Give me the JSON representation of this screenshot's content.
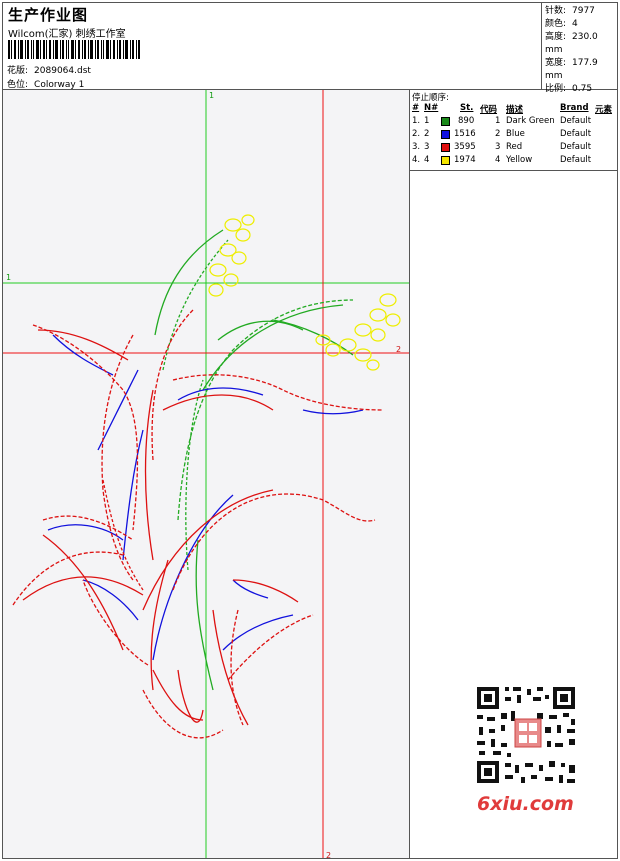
{
  "header": {
    "title": "生产作业图",
    "subtitle": "Wilcom(汇家) 刺绣工作室",
    "design_label": "花版:",
    "design_file": "2089064.dst",
    "color_label": "色位:",
    "colorway": "Colorway 1"
  },
  "stats": [
    {
      "key": "针数:",
      "value": "7977"
    },
    {
      "key": "颜色:",
      "value": "4"
    },
    {
      "key": "高度:",
      "value": "230.0 mm"
    },
    {
      "key": "宽度:",
      "value": "177.9 mm"
    },
    {
      "key": "比例:",
      "value": "0.75"
    }
  ],
  "stop_table": {
    "title": "停止顺序:",
    "headers": [
      "#",
      "N#",
      "St.",
      "代码",
      "描述",
      "Brand",
      "元素"
    ],
    "rows": [
      {
        "idx": "1.",
        "n": "1",
        "color": "#1a8a1a",
        "st": "890",
        "code": "1",
        "desc": "Dark Green",
        "brand": "Default"
      },
      {
        "idx": "2.",
        "n": "2",
        "color": "#1010e0",
        "st": "1516",
        "code": "2",
        "desc": "Blue",
        "brand": "Default"
      },
      {
        "idx": "3.",
        "n": "3",
        "color": "#e01010",
        "st": "3595",
        "code": "3",
        "desc": "Red",
        "brand": "Default"
      },
      {
        "idx": "4.",
        "n": "4",
        "color": "#f5e600",
        "st": "1974",
        "code": "4",
        "desc": "Yellow",
        "brand": "Default"
      }
    ]
  },
  "guides": {
    "green_label": "1",
    "red_label": "2"
  },
  "watermark": "6xiu.com",
  "colors": {
    "green": "#22aa22",
    "red": "#dd1111",
    "blue": "#1111dd",
    "yellow": "#eeee00"
  }
}
